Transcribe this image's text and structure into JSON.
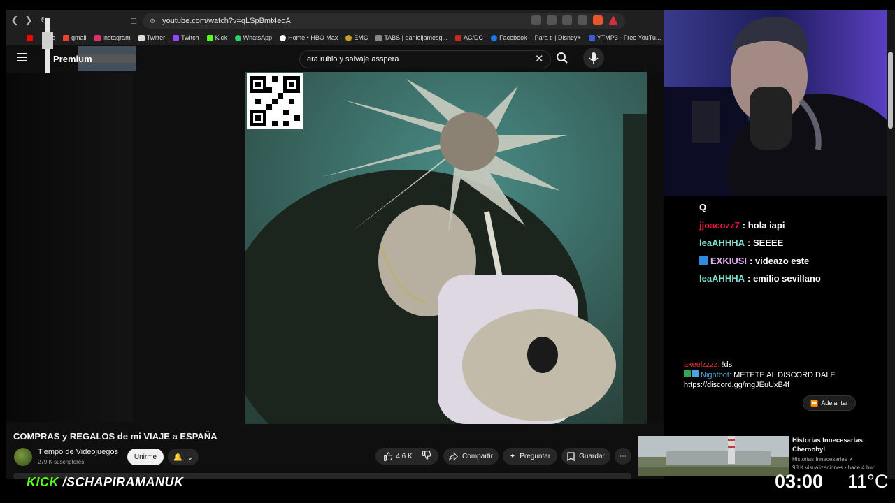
{
  "browser": {
    "url": "youtube.com/watch?v=qLSpBmt4eoA",
    "bookmarks": [
      "gmail",
      "Instagram",
      "Twitter",
      "Twitch",
      "Kick",
      "WhatsApp",
      "Home • HBO Max",
      "EMC",
      "TABS | danieljamesg...",
      "AC/DC",
      "Facebook",
      "Para ti | Disney+",
      "YTMP3 - Free YouTu..."
    ],
    "youtube_partial": "ube"
  },
  "yt": {
    "premium_label": "Premium",
    "search_value": "era rubio y salvaje asspera",
    "video_title": "COMPRAS y REGALOS de mi VIAJE a ESPAÑA",
    "channel_name": "Tiempo de Videojuegos",
    "subscribers": "279 K suscriptores",
    "join_label": "Unirme",
    "like_count": "4,6 K",
    "share_label": "Compartir",
    "ask_label": "Preguntar",
    "save_label": "Guardar"
  },
  "recommended": {
    "title": "Historias Innecesarias: Chernobyl",
    "channel": "Historias Innecesarias",
    "meta": "98 K visualizaciones • hace 4 hor..."
  },
  "chat": {
    "top_letter": "Q",
    "messages": [
      {
        "user": "jjoacozz7",
        "text": ": hola iapi",
        "color": "#e0163b"
      },
      {
        "user": "leaAHHHA",
        "text": ": SEEEE",
        "color": "#7fe0d2"
      },
      {
        "user": "EXKIUSI",
        "text": ": videazo este",
        "color": "#e0b0f0"
      },
      {
        "user": "leaAHHHA",
        "text": ": emilio sevillano",
        "color": "#7fe0d2"
      }
    ]
  },
  "bot_chat": {
    "user1": "axeelzzzz:",
    "user1_color": "#e8362c",
    "msg1": "!ds",
    "user2": "Nightbot:",
    "user2_color": "#4aa3e0",
    "msg2": "METETE AL DISCORD DALE",
    "link": "https://discord.gg/mgJEuUxB4f"
  },
  "adelantar_label": "Adelantar",
  "overlay": {
    "kick_prefix": "KICK",
    "kick_handle": "/SCHAPIRAMANUK",
    "time": "03:00",
    "temperature": "11°C"
  }
}
